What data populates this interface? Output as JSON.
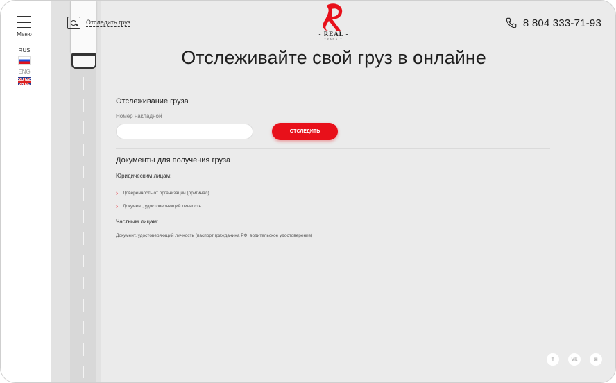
{
  "sidebar": {
    "menu_label": "Меню",
    "lang_rus": "RUS",
    "lang_eng": "ENG"
  },
  "header": {
    "track_link": "Отследить груз",
    "logo_text": "- REAL -",
    "logo_sub": "TRANSIT",
    "phone": "8 804 333-71-93"
  },
  "main": {
    "headline": "Отслеживайте свой груз в онлайне",
    "tracking_title": "Отслеживание груза",
    "waybill_label": "Номер накладной",
    "waybill_value": "",
    "track_button": "ОТСЛЕДИТЬ",
    "docs_title": "Документы для получения груза",
    "legal_title": "Юридическим лицам:",
    "legal_items": [
      "Доверенность от организации (оригинал)",
      "Документ, удостоверяющий личность"
    ],
    "private_title": "Частным лицам:",
    "private_doc": "Документ, удостоверяющий личность (паспорт гражданина РФ, водительское удостоверение)"
  },
  "social": {
    "facebook": "f",
    "vk": "vk",
    "instagram": "◙"
  },
  "colors": {
    "accent": "#e8101a",
    "background": "#ebebeb"
  }
}
